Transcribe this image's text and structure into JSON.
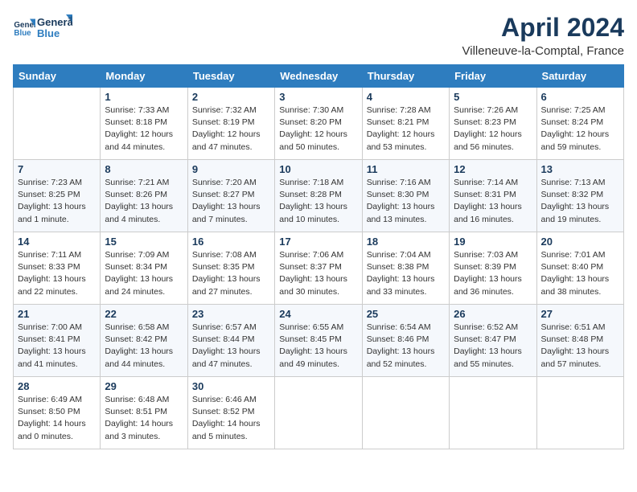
{
  "header": {
    "logo_line1": "General",
    "logo_line2": "Blue",
    "month": "April 2024",
    "location": "Villeneuve-la-Comptal, France"
  },
  "columns": [
    "Sunday",
    "Monday",
    "Tuesday",
    "Wednesday",
    "Thursday",
    "Friday",
    "Saturday"
  ],
  "weeks": [
    [
      {
        "day": "",
        "info": ""
      },
      {
        "day": "1",
        "info": "Sunrise: 7:33 AM\nSunset: 8:18 PM\nDaylight: 12 hours\nand 44 minutes."
      },
      {
        "day": "2",
        "info": "Sunrise: 7:32 AM\nSunset: 8:19 PM\nDaylight: 12 hours\nand 47 minutes."
      },
      {
        "day": "3",
        "info": "Sunrise: 7:30 AM\nSunset: 8:20 PM\nDaylight: 12 hours\nand 50 minutes."
      },
      {
        "day": "4",
        "info": "Sunrise: 7:28 AM\nSunset: 8:21 PM\nDaylight: 12 hours\nand 53 minutes."
      },
      {
        "day": "5",
        "info": "Sunrise: 7:26 AM\nSunset: 8:23 PM\nDaylight: 12 hours\nand 56 minutes."
      },
      {
        "day": "6",
        "info": "Sunrise: 7:25 AM\nSunset: 8:24 PM\nDaylight: 12 hours\nand 59 minutes."
      }
    ],
    [
      {
        "day": "7",
        "info": "Sunrise: 7:23 AM\nSunset: 8:25 PM\nDaylight: 13 hours\nand 1 minute."
      },
      {
        "day": "8",
        "info": "Sunrise: 7:21 AM\nSunset: 8:26 PM\nDaylight: 13 hours\nand 4 minutes."
      },
      {
        "day": "9",
        "info": "Sunrise: 7:20 AM\nSunset: 8:27 PM\nDaylight: 13 hours\nand 7 minutes."
      },
      {
        "day": "10",
        "info": "Sunrise: 7:18 AM\nSunset: 8:28 PM\nDaylight: 13 hours\nand 10 minutes."
      },
      {
        "day": "11",
        "info": "Sunrise: 7:16 AM\nSunset: 8:30 PM\nDaylight: 13 hours\nand 13 minutes."
      },
      {
        "day": "12",
        "info": "Sunrise: 7:14 AM\nSunset: 8:31 PM\nDaylight: 13 hours\nand 16 minutes."
      },
      {
        "day": "13",
        "info": "Sunrise: 7:13 AM\nSunset: 8:32 PM\nDaylight: 13 hours\nand 19 minutes."
      }
    ],
    [
      {
        "day": "14",
        "info": "Sunrise: 7:11 AM\nSunset: 8:33 PM\nDaylight: 13 hours\nand 22 minutes."
      },
      {
        "day": "15",
        "info": "Sunrise: 7:09 AM\nSunset: 8:34 PM\nDaylight: 13 hours\nand 24 minutes."
      },
      {
        "day": "16",
        "info": "Sunrise: 7:08 AM\nSunset: 8:35 PM\nDaylight: 13 hours\nand 27 minutes."
      },
      {
        "day": "17",
        "info": "Sunrise: 7:06 AM\nSunset: 8:37 PM\nDaylight: 13 hours\nand 30 minutes."
      },
      {
        "day": "18",
        "info": "Sunrise: 7:04 AM\nSunset: 8:38 PM\nDaylight: 13 hours\nand 33 minutes."
      },
      {
        "day": "19",
        "info": "Sunrise: 7:03 AM\nSunset: 8:39 PM\nDaylight: 13 hours\nand 36 minutes."
      },
      {
        "day": "20",
        "info": "Sunrise: 7:01 AM\nSunset: 8:40 PM\nDaylight: 13 hours\nand 38 minutes."
      }
    ],
    [
      {
        "day": "21",
        "info": "Sunrise: 7:00 AM\nSunset: 8:41 PM\nDaylight: 13 hours\nand 41 minutes."
      },
      {
        "day": "22",
        "info": "Sunrise: 6:58 AM\nSunset: 8:42 PM\nDaylight: 13 hours\nand 44 minutes."
      },
      {
        "day": "23",
        "info": "Sunrise: 6:57 AM\nSunset: 8:44 PM\nDaylight: 13 hours\nand 47 minutes."
      },
      {
        "day": "24",
        "info": "Sunrise: 6:55 AM\nSunset: 8:45 PM\nDaylight: 13 hours\nand 49 minutes."
      },
      {
        "day": "25",
        "info": "Sunrise: 6:54 AM\nSunset: 8:46 PM\nDaylight: 13 hours\nand 52 minutes."
      },
      {
        "day": "26",
        "info": "Sunrise: 6:52 AM\nSunset: 8:47 PM\nDaylight: 13 hours\nand 55 minutes."
      },
      {
        "day": "27",
        "info": "Sunrise: 6:51 AM\nSunset: 8:48 PM\nDaylight: 13 hours\nand 57 minutes."
      }
    ],
    [
      {
        "day": "28",
        "info": "Sunrise: 6:49 AM\nSunset: 8:50 PM\nDaylight: 14 hours\nand 0 minutes."
      },
      {
        "day": "29",
        "info": "Sunrise: 6:48 AM\nSunset: 8:51 PM\nDaylight: 14 hours\nand 3 minutes."
      },
      {
        "day": "30",
        "info": "Sunrise: 6:46 AM\nSunset: 8:52 PM\nDaylight: 14 hours\nand 5 minutes."
      },
      {
        "day": "",
        "info": ""
      },
      {
        "day": "",
        "info": ""
      },
      {
        "day": "",
        "info": ""
      },
      {
        "day": "",
        "info": ""
      }
    ]
  ]
}
